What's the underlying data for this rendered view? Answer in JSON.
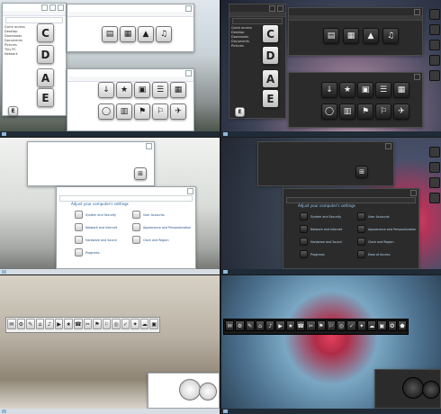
{
  "theme_preview": {
    "light_explorer_nav": [
      "Quick access",
      "Desktop",
      "Downloads",
      "Documents",
      "Pictures",
      "This PC",
      "Network"
    ],
    "dark_explorer_nav": [
      "Quick access",
      "Desktop",
      "Downloads",
      "Documents",
      "Pictures",
      "This PC",
      "Network"
    ],
    "drives": [
      "C",
      "D",
      "A",
      "E"
    ],
    "tiny_drive_label": "E",
    "library_icons_row1": [
      "▤",
      "▦",
      "▲",
      "♫"
    ],
    "library_icons_grid": [
      "↓",
      "★",
      "▣",
      "☰",
      "▦",
      "▤",
      "◯",
      "▥",
      "⚑",
      "⚐",
      "✈",
      "♪"
    ],
    "control_panel": {
      "header": "Adjust your computer's settings",
      "left_items": [
        "System and Security",
        "Network and Internet",
        "Hardware and Sound",
        "Programs"
      ],
      "right_items": [
        "User Accounts",
        "Appearance and Personalization",
        "Clock and Region",
        "Ease of Access"
      ]
    },
    "dock_glyphs": [
      "✉",
      "⚙",
      "✎",
      "⌂",
      "♪",
      "▶",
      "★",
      "☎",
      "✂",
      "⚑",
      "⚐",
      "◎",
      "✓",
      "✦",
      "☁",
      "▣"
    ],
    "dark_dock_glyphs": [
      "✉",
      "⚙",
      "✎",
      "⌂",
      "♪",
      "▶",
      "★",
      "☎",
      "✂",
      "⚑",
      "⚐",
      "◎",
      "✓",
      "✦",
      "☁",
      "▣",
      "✪",
      "⬟"
    ]
  }
}
